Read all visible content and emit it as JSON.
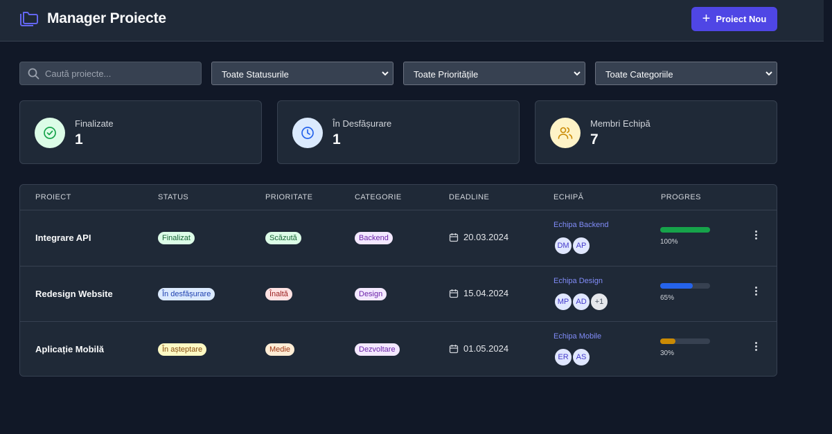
{
  "header": {
    "title": "Manager Proiecte",
    "new_button": "Proiect Nou"
  },
  "filters": {
    "search_placeholder": "Caută proiecte...",
    "status": "Toate Statusurile",
    "priority": "Toate Prioritățile",
    "category": "Toate Categoriile"
  },
  "stats": [
    {
      "label": "Finalizate",
      "value": "1",
      "icon": "check-circle-icon"
    },
    {
      "label": "În Desfășurare",
      "value": "1",
      "icon": "clock-icon"
    },
    {
      "label": "Membri Echipă",
      "value": "7",
      "icon": "users-icon"
    }
  ],
  "table": {
    "columns": [
      "PROIECT",
      "STATUS",
      "PRIORITATE",
      "CATEGORIE",
      "DEADLINE",
      "ECHIPĂ",
      "PROGRES"
    ],
    "rows": [
      {
        "name": "Integrare API",
        "status": "Finalizat",
        "priority": "Scăzută",
        "category": "Backend",
        "deadline": "20.03.2024",
        "team": "Echipa Backend",
        "members": [
          "DM",
          "AP"
        ],
        "extra": "",
        "progress": 100,
        "progress_label": "100%",
        "progress_color": "#16a34a"
      },
      {
        "name": "Redesign Website",
        "status": "În desfășurare",
        "priority": "Înaltă",
        "category": "Design",
        "deadline": "15.04.2024",
        "team": "Echipa Design",
        "members": [
          "MP",
          "AD"
        ],
        "extra": "+1",
        "progress": 65,
        "progress_label": "65%",
        "progress_color": "#2563eb"
      },
      {
        "name": "Aplicație Mobilă",
        "status": "În așteptare",
        "priority": "Medie",
        "category": "Dezvoltare",
        "deadline": "01.05.2024",
        "team": "Echipa Mobile",
        "members": [
          "ER",
          "AS"
        ],
        "extra": "",
        "progress": 30,
        "progress_label": "30%",
        "progress_color": "#ca8a04"
      }
    ]
  },
  "colors": {
    "accent": "#4f46e5",
    "background": "#111827",
    "surface": "#1f2937"
  }
}
